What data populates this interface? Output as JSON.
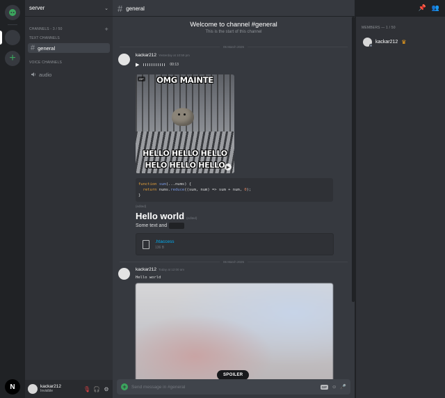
{
  "server": {
    "name": "server"
  },
  "rail": {
    "n_label": "N"
  },
  "sidebar": {
    "text_channels_label": "CHANNELS - 3 / 50",
    "text_section": "TEXT CHANNELS",
    "voice_section": "VOICE CHANNELS",
    "channels": [
      {
        "label": "general",
        "type": "text",
        "active": true
      },
      {
        "label": "audio",
        "type": "voice",
        "active": false
      }
    ]
  },
  "user_panel": {
    "name": "kackar212",
    "status": "Invisible"
  },
  "chat": {
    "channel_name": "general",
    "welcome_title": "Welcome to channel #general",
    "welcome_sub": "This is the start of this channel",
    "date1": "05 March 2025",
    "date2": "06 March 2025",
    "msg1": {
      "author": "kackar212",
      "time": "Yesterday at 10:59 pm",
      "audio_time": "00:13",
      "gif_badge": "GIF",
      "gif_caption_top": "OMG MAINTE",
      "gif_caption_b1": "HELLO HELLO HELLO",
      "gif_caption_b2": "HELO HELLO HELLO",
      "code_lines": [
        "function sum(...nums) {",
        "  return nums.reduce((sum, num) => sum + num, 0);",
        "}"
      ],
      "edited_label": "(edited)",
      "heading": "Hello world",
      "heading_edited": "(edited)",
      "sometext": "Some text and",
      "file_name": ".htaccess",
      "file_size": "136 B"
    },
    "msg2": {
      "author": "kackar212",
      "time": "Today at 12:00 am",
      "text": "Hello world",
      "spoiler_label": "SPOILER"
    },
    "composer_placeholder": "Send message in #general",
    "gif_button": "GIF"
  },
  "members": {
    "header": "MEMBERS — 1 / 50",
    "list": [
      {
        "name": "kackar212",
        "owner": true
      }
    ]
  }
}
